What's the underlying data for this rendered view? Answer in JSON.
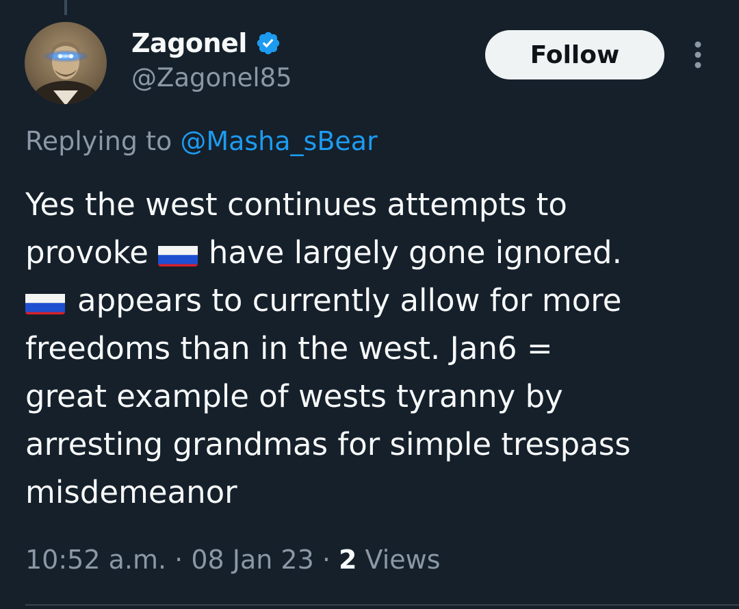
{
  "author": {
    "display_name": "Zagonel",
    "handle": "@Zagonel85",
    "verified": true
  },
  "follow_label": "Follow",
  "reply": {
    "prefix": "Replying to ",
    "mention": "@Masha_sBear"
  },
  "tweet": {
    "line1": "Yes the west continues attempts to",
    "line2_a": "provoke",
    "line2_b": "have largely gone ignored.",
    "line3": "appears to currently allow for more",
    "line4": "freedoms than in the west. Jan6 =",
    "line5": "great example of wests tyranny by",
    "line6": "arresting grandmas for simple trespass",
    "line7": "misdemeanor",
    "flags": [
      "russia-flag-emoji",
      "russia-flag-emoji"
    ]
  },
  "meta": {
    "time": "10:52 a.m.",
    "sep1": " · ",
    "date": "08 Jan 23",
    "sep2": " · ",
    "views_count": "2",
    "views_label": " Views"
  },
  "colors": {
    "background": "#15202b",
    "text": "#f7f9f9",
    "muted": "#8b98a5",
    "accent": "#1d9bf0",
    "follow_bg": "#eff3f4"
  },
  "icons": {
    "verified": "verified-badge-icon",
    "more": "more-options-icon"
  }
}
